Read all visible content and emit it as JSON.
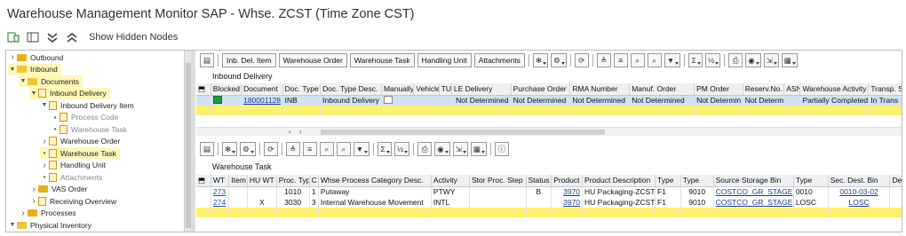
{
  "window": {
    "title": "Warehouse Management Monitor SAP - Whse. ZCST (Time Zone CST)"
  },
  "toolbar": {
    "show_hidden": "Show Hidden Nodes"
  },
  "tree": [
    {
      "label": "Outbound",
      "level": 0,
      "type": "folder",
      "expanded": false,
      "selected": false
    },
    {
      "label": "Inbound",
      "level": 0,
      "type": "folder",
      "expanded": true,
      "selected": true
    },
    {
      "label": "Documents",
      "level": 1,
      "type": "folder",
      "expanded": true,
      "selected": true
    },
    {
      "label": "Inbound Delivery",
      "level": 2,
      "type": "doc",
      "expanded": true,
      "selected": true
    },
    {
      "label": "Inbound Delivery Item",
      "level": 3,
      "type": "doc",
      "expanded": true,
      "selected": false
    },
    {
      "label": "Process Code",
      "level": 4,
      "type": "doc",
      "leaf": true,
      "muted": true
    },
    {
      "label": "Warehouse Task",
      "level": 4,
      "type": "doc",
      "leaf": true,
      "muted": true
    },
    {
      "label": "Warehouse Order",
      "level": 3,
      "type": "doc",
      "expanded": false,
      "selected": false
    },
    {
      "label": "Warehouse Task",
      "level": 3,
      "type": "doc",
      "leaf": true,
      "selected": true
    },
    {
      "label": "Handling Unit",
      "level": 3,
      "type": "doc",
      "expanded": false,
      "selected": false
    },
    {
      "label": "Attachments",
      "level": 3,
      "type": "doc",
      "leaf": true,
      "muted": true
    },
    {
      "label": "VAS Order",
      "level": 2,
      "type": "folder",
      "expanded": false,
      "selected": false
    },
    {
      "label": "Receiving Overview",
      "level": 2,
      "type": "doc",
      "expanded": false,
      "selected": false
    },
    {
      "label": "Processes",
      "level": 1,
      "type": "folder",
      "expanded": false,
      "selected": false
    },
    {
      "label": "Physical Inventory",
      "level": 0,
      "type": "folder",
      "expanded": true,
      "selected": false
    }
  ],
  "top": {
    "buttons": [
      "Inb. Del. Item",
      "Warehouse Order",
      "Warehouse Task",
      "Handling Unit",
      "Attachments"
    ],
    "title": "Inbound Delivery",
    "columns": [
      "",
      "Blocked",
      "Document",
      "Doc. Type",
      "Doc. Type Desc.",
      "Manually",
      "Vehicle",
      "TU",
      "LE Delivery",
      "Purchase Order",
      "RMA Number",
      "Manuf. Order",
      "PM Order",
      "Reserv.No.",
      "ASN",
      "Warehouse Activity",
      "Transp. S"
    ],
    "rows": [
      {
        "document": "180001128",
        "doc_type": "INB",
        "doc_type_desc": "Inbound Delivery",
        "le_delivery": "Not Determined",
        "purchase_order": "Not Determined",
        "rma": "Not Determined",
        "manuf_order": "Not Determined",
        "pm_order": "Not Determin",
        "reserv": "Not Determ",
        "activity": "Partially Completed",
        "transp": "In Trans"
      }
    ]
  },
  "bottom": {
    "title": "Warehouse Task",
    "columns": [
      "",
      "WT",
      "Item",
      "HU WT",
      "Proc. Type",
      "C",
      "Whse Process Category Desc.",
      "Activity",
      "Stor Proc. Step",
      "Status",
      "Product",
      "Product Description",
      "Type",
      "Type",
      "Source Storage Bin",
      "Type",
      "Sec. Dest. Bin",
      "De"
    ],
    "rows": [
      {
        "wt": "273",
        "item": "",
        "hu_wt": "",
        "proc_type": "1010",
        "c": "1",
        "cat_desc": "Putaway",
        "activity": "PTWY",
        "stor": "",
        "status": "B",
        "product": "3970",
        "prod_desc": "HU Packaging-ZCST",
        "type1": "F1",
        "type2": "9010",
        "src_bin": "COSTCO_GR_STAGE",
        "type3": "0010",
        "dest_bin": "0010-03-02"
      },
      {
        "wt": "274",
        "item": "",
        "hu_wt": "X",
        "proc_type": "3030",
        "c": "3",
        "cat_desc": "Internal Warehouse Movement",
        "activity": "INTL",
        "stor": "",
        "status": "",
        "product": "3970",
        "prod_desc": "HU Packaging-ZCST",
        "type1": "F1",
        "type2": "9010",
        "src_bin": "COSTCO_GR_STAGE",
        "type3": "LOSC",
        "dest_bin": "LOSC"
      }
    ]
  }
}
